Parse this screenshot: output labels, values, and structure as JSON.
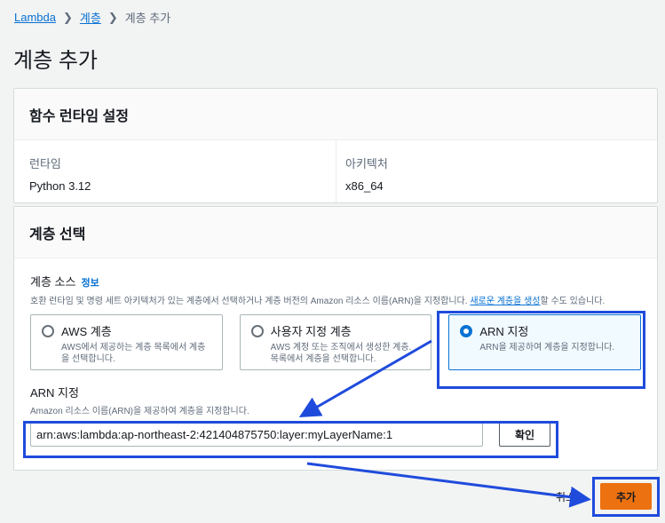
{
  "breadcrumb": {
    "items": [
      "Lambda",
      "계층"
    ],
    "current": "계층 추가"
  },
  "page_title": "계층 추가",
  "runtime_settings": {
    "header": "함수 런타임 설정",
    "runtime_label": "런타임",
    "runtime_value": "Python 3.12",
    "arch_label": "아키텍처",
    "arch_value": "x86_64"
  },
  "layer_select": {
    "header": "계층 선택",
    "source_label": "계층 소스",
    "info_link": "정보",
    "source_desc": "호환 런타임 및 명령 세트 아키텍처가 있는 계층에서 선택하거나 계층 버전의 Amazon 리소스 이름(ARN)을 지정합니다.",
    "source_desc_link": "새로운 계층을 생성",
    "source_desc_tail": "할 수도 있습니다.",
    "options": [
      {
        "label": "AWS 계층",
        "desc": "AWS에서 제공하는 계층 목록에서 계층을 선택합니다.",
        "selected": false
      },
      {
        "label": "사용자 지정 계층",
        "desc": "AWS 계정 또는 조직에서 생성한 계층. 목록에서 계층을 선택합니다.",
        "selected": false
      },
      {
        "label": "ARN 지정",
        "desc": "ARN을 제공하여 계층을 지정합니다.",
        "selected": true
      }
    ],
    "arn_label": "ARN 지정",
    "arn_desc": "Amazon 리소스 이름(ARN)을 제공하여 계층을 지정합니다.",
    "arn_value": "arn:aws:lambda:ap-northeast-2:421404875750:layer:myLayerName:1",
    "confirm_label": "확인"
  },
  "footer": {
    "cancel_label": "취소",
    "add_label": "추가"
  },
  "colors": {
    "accent": "#0972d3",
    "primary_button": "#ec7211",
    "highlight": "#1f4bdc"
  }
}
